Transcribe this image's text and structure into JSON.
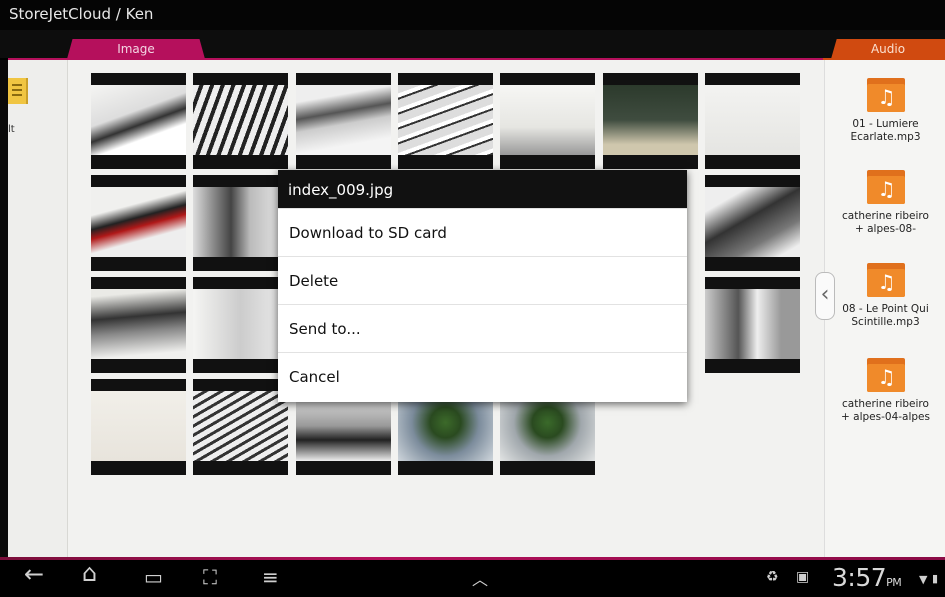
{
  "window": {
    "title": "StoreJetCloud / Ken"
  },
  "tabs": {
    "image": "Image",
    "audio": "Audio"
  },
  "left_panel": {
    "partial_label": "lt"
  },
  "dialog": {
    "title": "index_009.jpg",
    "items": [
      "Download to SD card",
      "Delete",
      "Send to...",
      "Cancel"
    ]
  },
  "audio_files": [
    {
      "name_line1": "01 - Lumiere",
      "name_line2": "Ecarlate.mp3"
    },
    {
      "name_line1": "catherine ribeiro",
      "name_line2": "+ alpes-08-"
    },
    {
      "name_line1": "08 - Le Point Qui",
      "name_line2": "Scintille.mp3"
    },
    {
      "name_line1": "catherine ribeiro",
      "name_line2": "+ alpes-04-alpes"
    }
  ],
  "status_bar": {
    "time": "3:57",
    "ampm": "PM"
  },
  "icons": {
    "back": "back-arrow-icon",
    "home": "home-icon",
    "recent": "recent-apps-icon",
    "screenshot": "screenshot-icon",
    "menu": "menu-icon",
    "up": "chevron-up-icon",
    "recycle": "recycle-icon",
    "bag": "shopping-bag-icon",
    "wifi": "wifi-icon",
    "battery": "battery-icon"
  },
  "colors": {
    "image_tab": "#b5105c",
    "audio_tab": "#d04a10"
  }
}
